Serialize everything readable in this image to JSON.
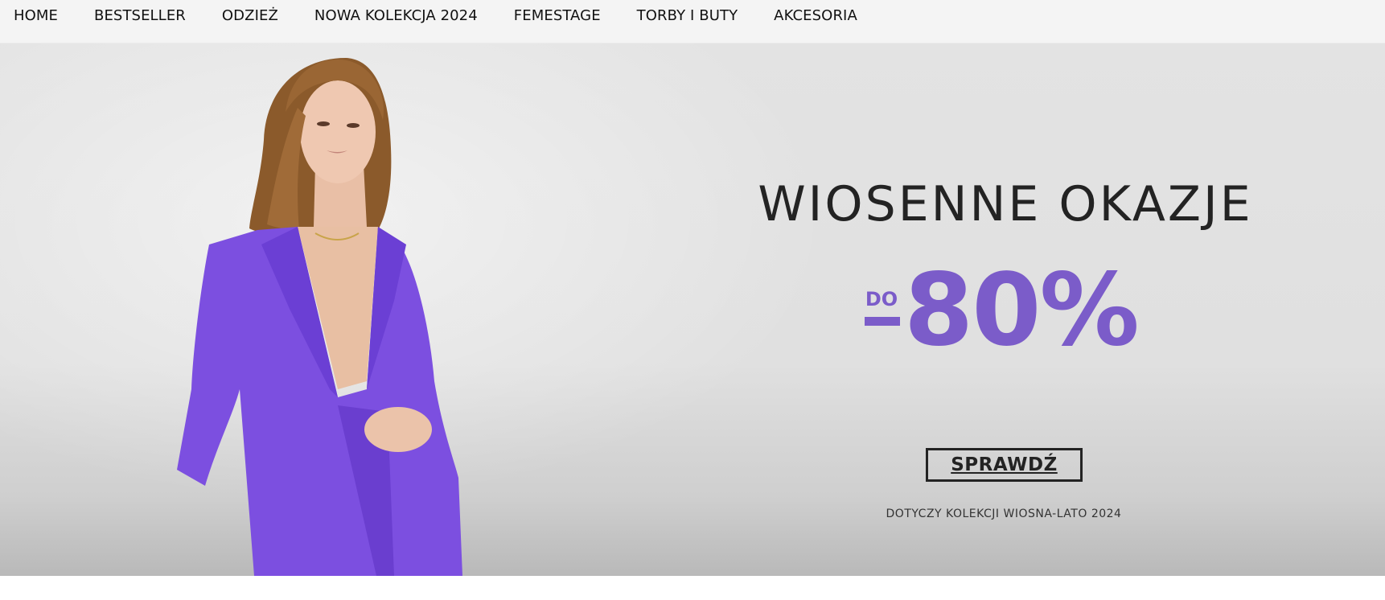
{
  "nav": {
    "items": [
      {
        "label": "HOME"
      },
      {
        "label": "BESTSELLER"
      },
      {
        "label": "ODZIEŻ"
      },
      {
        "label": "NOWA KOLEKCJA 2024"
      },
      {
        "label": "FEMESTAGE"
      },
      {
        "label": "TORBY I BUTY"
      },
      {
        "label": "AKCESORIA"
      }
    ]
  },
  "hero": {
    "title": "WIOSENNE OKAZJE",
    "discount_prefix": "DO",
    "discount_value": "80%",
    "cta_label": "SPRAWDŹ",
    "footnote": "DOTYCZY KOLEKCJI WIOSNA-LATO 2024",
    "image": "woman-in-purple-blazer"
  },
  "colors": {
    "accent": "#7b5cc9",
    "blazer": "#7c4fe0",
    "text_dark": "#232323",
    "nav_bg": "#f4f4f4",
    "hero_bg": "#e2e2e2"
  }
}
